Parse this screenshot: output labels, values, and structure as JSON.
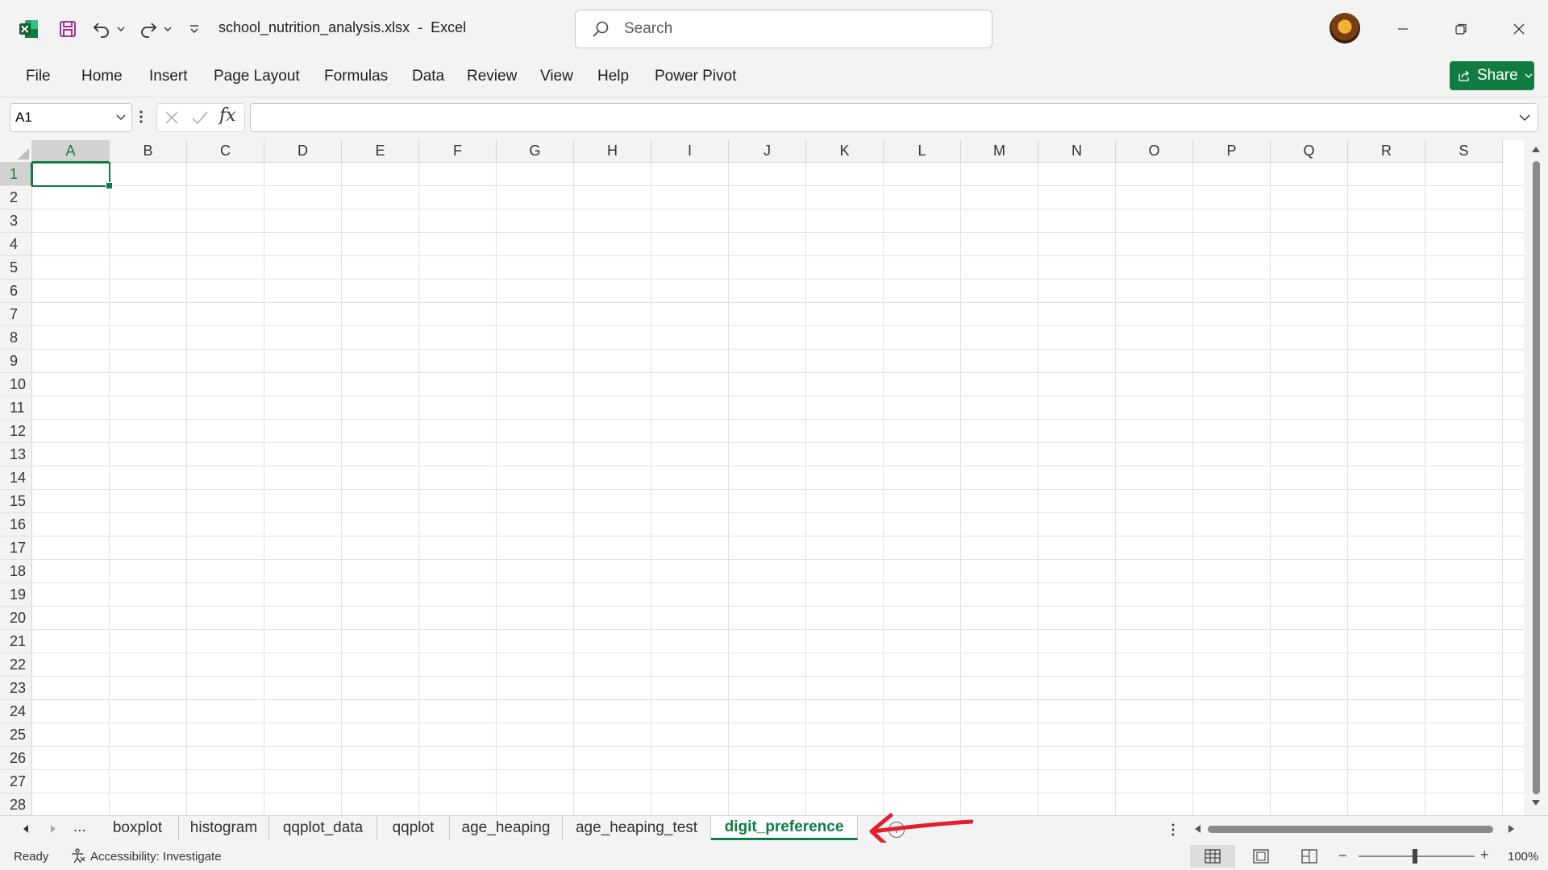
{
  "window": {
    "file_name": "school_nutrition_analysis.xlsx",
    "separator": "-",
    "app_name": "Excel",
    "search_placeholder": "Search"
  },
  "ribbon": {
    "tabs": [
      "File",
      "Home",
      "Insert",
      "Page Layout",
      "Formulas",
      "Data",
      "Review",
      "View",
      "Help",
      "Power Pivot"
    ],
    "share_label": "Share"
  },
  "formula_bar": {
    "name_box": "A1",
    "fx_label": "fx",
    "formula": ""
  },
  "grid": {
    "columns": [
      "A",
      "B",
      "C",
      "D",
      "E",
      "F",
      "G",
      "H",
      "I",
      "J",
      "K",
      "L",
      "M",
      "N",
      "O",
      "P",
      "Q",
      "R",
      "S"
    ],
    "rows": [
      "1",
      "2",
      "3",
      "4",
      "5",
      "6",
      "7",
      "8",
      "9",
      "10",
      "11",
      "12",
      "13",
      "14",
      "15",
      "16",
      "17",
      "18",
      "19",
      "20",
      "21",
      "22",
      "23",
      "24",
      "25",
      "26",
      "27",
      "28"
    ],
    "selected_cell": "A1"
  },
  "sheets": {
    "more_label": "...",
    "tabs": [
      "boxplot",
      "histogram",
      "qqplot_data",
      "qqplot",
      "age_heaping",
      "age_heaping_test",
      "digit_preference"
    ],
    "active": "digit_preference",
    "add_label": "+"
  },
  "status": {
    "ready": "Ready",
    "accessibility": "Accessibility: Investigate",
    "zoom_minus": "−",
    "zoom_plus": "+",
    "zoom": "100%"
  },
  "colors": {
    "accent": "#107c41",
    "annotation_arrow": "#e0202f"
  }
}
